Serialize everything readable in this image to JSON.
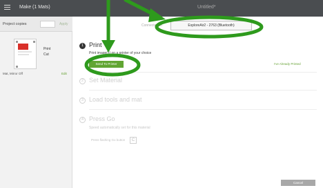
{
  "topbar": {
    "menu_icon": "hamburger-icon",
    "title": "Make (1 Mats)",
    "right_text": "Untitled*"
  },
  "left_panel": {
    "copies_label": "Project copies",
    "copies_value": "",
    "apply_label": "Apply",
    "mat": {
      "line1": "Print",
      "line2": "Cut",
      "mat_setting": "Mat, Mirror Off",
      "edit_label": "Edit"
    }
  },
  "main": {
    "status_label": "Connected to",
    "device_label": "ExploreAir2 - 2763 (Bluetooth)",
    "steps": [
      {
        "number": "1",
        "title": "Print",
        "desc": "Print image(s) on a printer of your choice"
      },
      {
        "number": "2",
        "title": "Set Material",
        "desc": ""
      },
      {
        "number": "3",
        "title": "Load tools and mat",
        "desc": ""
      },
      {
        "number": "4",
        "title": "Press Go",
        "desc": "Speed automatically set for this material"
      }
    ],
    "send_button": "Send To Printer",
    "already_printed": "I've Already Printed",
    "press_flashing": "Press flashing Go button",
    "go_icon": "cricut-go-icon",
    "cancel_label": "Cancel"
  },
  "colors": {
    "topbar": "#4a4d50",
    "green": "#61a533",
    "annotation": "#2e9a1d"
  }
}
